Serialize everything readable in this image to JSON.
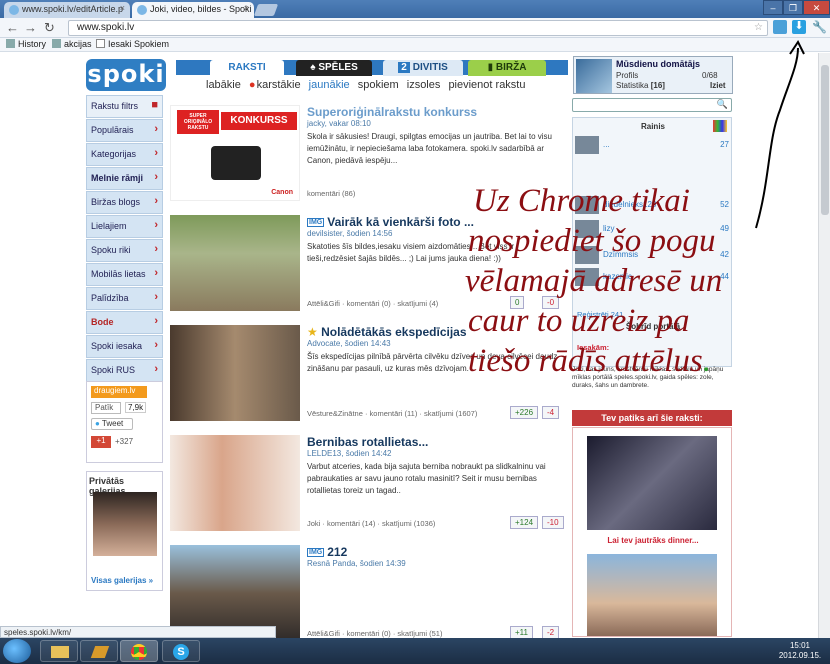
{
  "browser": {
    "tabs": [
      {
        "title": "www.spoki.lv/editArticle.p",
        "active": false
      },
      {
        "title": "Joki, video, bildes - Spoki",
        "active": true
      }
    ],
    "url": "www.spoki.lv",
    "bookmarks": [
      "History",
      "akcijas",
      "Iesaki Spokiem"
    ],
    "status_url": "speles.spoki.lv/km/"
  },
  "site": {
    "logo": "spoki",
    "nav_tabs": [
      "RAKSTI",
      "SPĒLES",
      "DIVITIS",
      "BIRŽA"
    ],
    "divitis_badge": "2",
    "subnav": [
      "labākie",
      "karstākie",
      "jaunākie",
      "spokiem",
      "izsoles",
      "pievienot rakstu"
    ],
    "subnav_active": "jaunākie",
    "userbox": {
      "title": "Mūsdienu domātājs",
      "profile": "Profils",
      "stats": "Statistika",
      "stats_count": "[16]",
      "mail": "0/68",
      "logout": "Iziet"
    }
  },
  "sidebar": {
    "items": [
      {
        "label": "Rakstu filtrs",
        "style": "filter"
      },
      {
        "label": "Populārais",
        "style": "normal"
      },
      {
        "label": "Kategorijas",
        "style": "normal"
      },
      {
        "label": "Melnie rāmji",
        "style": "bold"
      },
      {
        "label": "Biržas blogs",
        "style": "normal"
      },
      {
        "label": "Lielajiem",
        "style": "normal"
      },
      {
        "label": "Spoku riki",
        "style": "normal"
      },
      {
        "label": "Mobilās lietas",
        "style": "normal"
      },
      {
        "label": "Palīdzība",
        "style": "normal"
      },
      {
        "label": "Bode",
        "style": "red"
      },
      {
        "label": "Spoki iesaka",
        "style": "normal"
      },
      {
        "label": "Spoki RUS",
        "style": "normal"
      }
    ],
    "draugiem": "draugiem.lv",
    "patik": "Patīk",
    "patik_count": "7,9k",
    "tweet": "Tweet",
    "gplus": "+1",
    "gplus_count": "+327",
    "gallery_title": "Privātās galerijas",
    "gallery_link": "Visas galerijas »"
  },
  "articles": [
    {
      "title": "Superoriģinālrakstu konkurss",
      "meta": "jacky, vakar 08:10",
      "text": "Skola ir sākusies! Draugi, spilgtas emocijas un jautriba. Bet lai to visu iemūžinātu, ir nepieciešama laba fotokamera. spoki.lv sadarbībā ar Canon, piedāvā iespēju...",
      "foot": "komentāri (86)",
      "up": "",
      "down": "",
      "title_color": "#6b9ccb",
      "thumb_caption": "SUPER ORIĢINĀLO RAKSTU",
      "thumb_word": "KONKURSS",
      "thumb_brand": "Canon"
    },
    {
      "title": "Vairāk kā vienkārši foto ...",
      "meta": "devilsister, šodien 14:56",
      "text": "Skatoties šīs bildes,iesaku visiem aizdomāties... Bet viss ir tieši,redzēsiet šajās bildēs... ;) Lai jums jauka diena! :))",
      "foot": "Attēli&Gifi · komentāri (0) · skatījumi (4)",
      "up": "0",
      "down": "-0",
      "title_color": "#16385e"
    },
    {
      "title": "Nolādētākās ekspedīcijas",
      "meta": "Advocate, šodien 14:43",
      "text": "Šīs ekspedīcijas pilnībā pārvērta cilvēku dzīves un deva cilvēcei daudz zināšanu par pasauli, uz kuras mēs dzīvojam.",
      "foot": "Vēsture&Zinātne · komentāri (11) · skatījumi (1607)",
      "up": "+226",
      "down": "-4",
      "title_color": "#16385e"
    },
    {
      "title": "Bernibas rotallietas...",
      "meta": "LELDE13, šodien 14:42",
      "text": "Varbut atceries, kada bija sajuta berniba nobraukt pa slidkalninu vai pabraukaties ar savu jauno rotalu masinitī? Seit ir musu bernibas rotallietas toreiz un tagad..",
      "foot": "Joki · komentāri (14) · skatījumi (1036)",
      "up": "+124",
      "down": "-10",
      "title_color": "#16385e"
    },
    {
      "title": "212",
      "meta": "Resnā Panda, šodien 14:39",
      "text": "",
      "foot": "Attēli&Gifi · komentāri (0) · skatījumi (51)",
      "up": "+11",
      "down": "-2",
      "title_color": "#16385e"
    }
  ],
  "right": {
    "rainis_title": "Rainis",
    "users": [
      {
        "name": "...",
        "count": "27"
      },
      {
        "name": "diedelnieks123",
        "count": "52"
      },
      {
        "name": "lizy",
        "count": "49"
      },
      {
        "name": "Dzīmmsis",
        "count": "42"
      },
      {
        "name": "kazeniic",
        "count": "44"
      }
    ],
    "registered": "Reģistrēti 241",
    "sobrid": "Šobrīd portālā",
    "iesakam_label": "Iesakām:",
    "iesakam_text": "Joki,Kas jauns, krustvārdu mīklas, sudoku un japāņu mīklas portālā speles.spoki.lv, gaida spēles: zole, duraks, šahs un dambrete.",
    "tev_patiks": "Tev patiks arī šie raksti:",
    "rec_title": "Lai tev jautrāks dinner..."
  },
  "overlay": {
    "lines": [
      "Uz Chrome tikai",
      "nospiediet šo pogu",
      "vēlamajā adresē un",
      "caur to uzreiz pa",
      "tiešo rādīs attēlus"
    ],
    "period": "."
  },
  "taskbar": {
    "time": "15:01",
    "date": "2012.09.15."
  },
  "colors": {
    "accent": "#2e78c0",
    "overlay_text": "#8b0e12",
    "red_badge": "#c23a3a"
  }
}
